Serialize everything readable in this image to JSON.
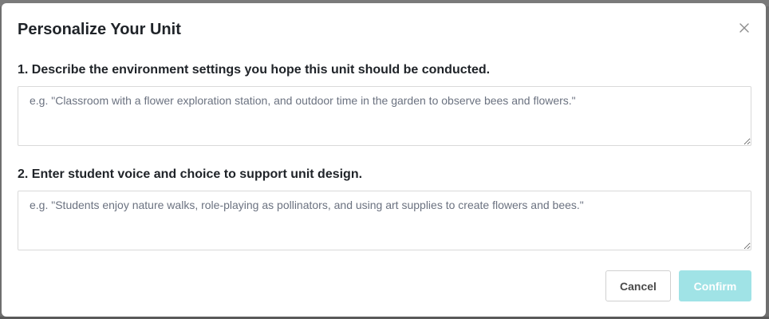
{
  "modal": {
    "title": "Personalize Your Unit",
    "close_icon": "close-icon"
  },
  "questions": [
    {
      "label": "1. Describe the environment settings you hope this unit should be conducted.",
      "value": "",
      "placeholder": "e.g. \"Classroom with a flower exploration station, and outdoor time in the garden to observe bees and flowers.\""
    },
    {
      "label": "2. Enter student voice and choice to support unit design.",
      "value": "",
      "placeholder": "e.g. \"Students enjoy nature walks, role-playing as pollinators, and using art supplies to create flowers and bees.\""
    }
  ],
  "footer": {
    "cancel_label": "Cancel",
    "confirm_label": "Confirm"
  },
  "colors": {
    "confirm_disabled_bg": "#a0e3e6",
    "backdrop": "#6f6f6f"
  }
}
